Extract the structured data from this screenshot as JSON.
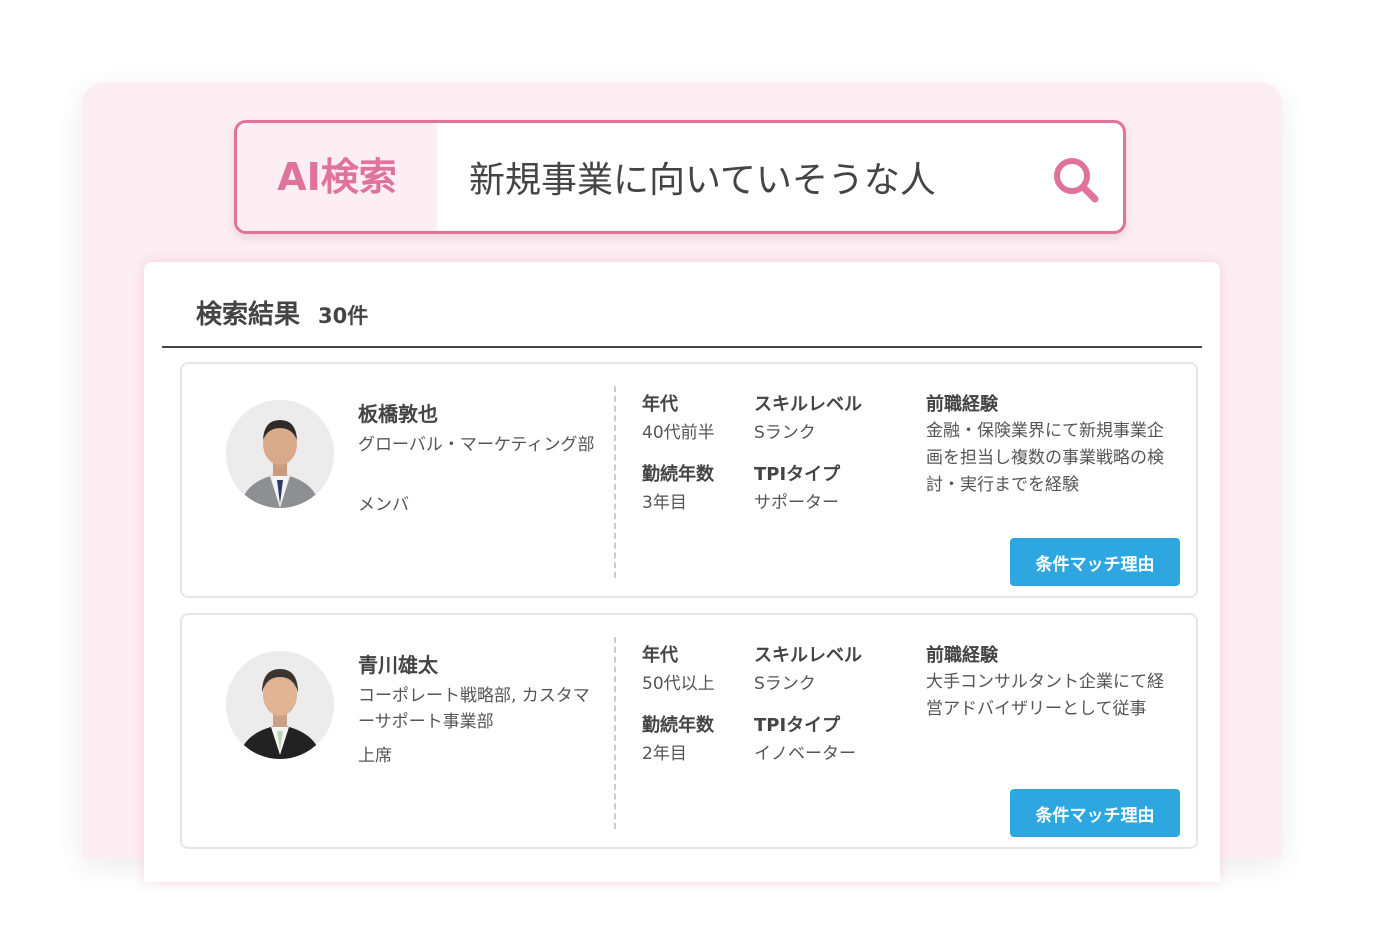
{
  "search": {
    "tag": "AI検索",
    "query": "新規事業に向いていそうな人"
  },
  "results": {
    "title": "検索結果",
    "count": "30件"
  },
  "labels": {
    "age": "年代",
    "skill": "スキルレベル",
    "tenure": "勤続年数",
    "tpi": "TPIタイプ",
    "experience": "前職経験",
    "match_button": "条件マッチ理由"
  },
  "people": [
    {
      "name": "板橋敦也",
      "department": "グローバル・マーケティング部",
      "role": "メンバ",
      "age": "40代前半",
      "skill": "Sランク",
      "tenure": "3年目",
      "tpi": "サポーター",
      "experience": "金融・保険業界にて新規事業企画を担当し複数の事業戦略の検討・実行までを経験"
    },
    {
      "name": "青川雄太",
      "department": "コーポレート戦略部, カスタマーサポート事業部",
      "role": "上席",
      "age": "50代以上",
      "skill": "Sランク",
      "tenure": "2年目",
      "tpi": "イノベーター",
      "experience": "大手コンサルタント企業にて経営アドバイザリーとして従事"
    }
  ],
  "colors": {
    "accent_pink": "#e0739c",
    "panel_bg": "#fdeef3",
    "button_blue": "#2ea7e0"
  }
}
